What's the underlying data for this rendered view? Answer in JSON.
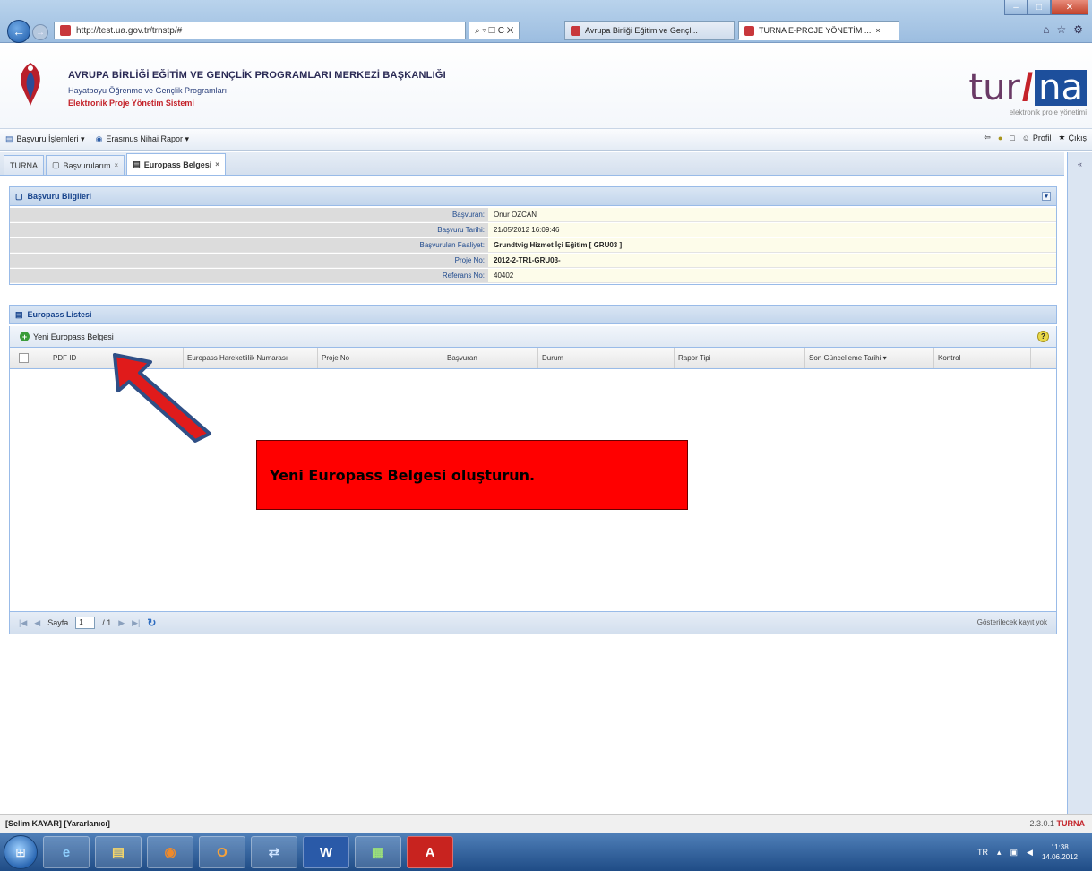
{
  "browser": {
    "url": "http://test.ua.gov.tr/trnstp/#",
    "address_tools": "⌕ ▿ ☐ C ✕",
    "tabs": [
      {
        "label": "Avrupa Birliği Eğitim ve Gençl..."
      },
      {
        "label": "TURNA E-PROJE YÖNETİM ...",
        "close": "×"
      }
    ],
    "window_controls": {
      "minimize": "–",
      "maximize": "□",
      "close": "✕"
    }
  },
  "header": {
    "org_title": "AVRUPA BİRLİĞİ EĞİTİM VE GENÇLİK PROGRAMLARI MERKEZİ BAŞKANLIĞI",
    "org_subtitle": "Hayatboyu Öğrenme ve Gençlik Programları",
    "system_name": "Elektronik Proje Yönetim Sistemi",
    "logo_text_left": "tur",
    "logo_slash": "/",
    "logo_text_right": "na",
    "logo_caption": "elektronik proje yönetimi"
  },
  "menu": {
    "items": [
      {
        "label": "Başvuru İşlemleri ▾"
      },
      {
        "label": "Erasmus Nihai Rapor ▾"
      }
    ],
    "right": {
      "profile": "Profil",
      "exit": "Çıkış"
    }
  },
  "app_tabs": [
    {
      "label": "TURNA"
    },
    {
      "label": "Başvurularım",
      "close": "×"
    },
    {
      "label": "Europass Belgesi",
      "close": "×"
    }
  ],
  "info_panel": {
    "title": "Başvuru Bilgileri",
    "rows": [
      {
        "label": "Başvuran:",
        "value": "Onur ÖZCAN",
        "bold": false
      },
      {
        "label": "Başvuru Tarihi:",
        "value": "21/05/2012 16:09:46",
        "bold": false
      },
      {
        "label": "Başvurulan Faaliyet:",
        "value": "Grundtvig Hizmet İçi Eğitim  [ GRU03 ]",
        "bold": true
      },
      {
        "label": "Proje No:",
        "value": "2012-2-TR1-GRU03-",
        "bold": true
      },
      {
        "label": "Referans No:",
        "value": "40402",
        "bold": false
      }
    ]
  },
  "list_panel": {
    "title": "Europass Listesi",
    "new_button": "Yeni Europass Belgesi",
    "columns": [
      "PDF ID",
      "Europass Hareketlilik Numarası",
      "Proje No",
      "Başvuran",
      "Durum",
      "Rapor Tipi",
      "Son Güncelleme Tarihi ▾",
      "Kontrol"
    ],
    "pager": {
      "page_label": "Sayfa",
      "page_value": "1",
      "of_label": "/ 1",
      "status": "Gösterilecek kayıt yok"
    }
  },
  "annotation": {
    "callout_text": "Yeni Europass Belgesi oluşturun.",
    "color": "#ff0000"
  },
  "statusbar": {
    "user": "[Selim KAYAR] [Yararlanıcı]",
    "version": "2.3.0.1",
    "brand": "TURNA"
  },
  "taskbar": {
    "apps": [
      "e",
      "▤",
      "◉",
      "O",
      "⇄",
      "W",
      "▦",
      "A"
    ],
    "tray_lang": "TR",
    "time": "11:38",
    "date": "14.06.2012"
  }
}
